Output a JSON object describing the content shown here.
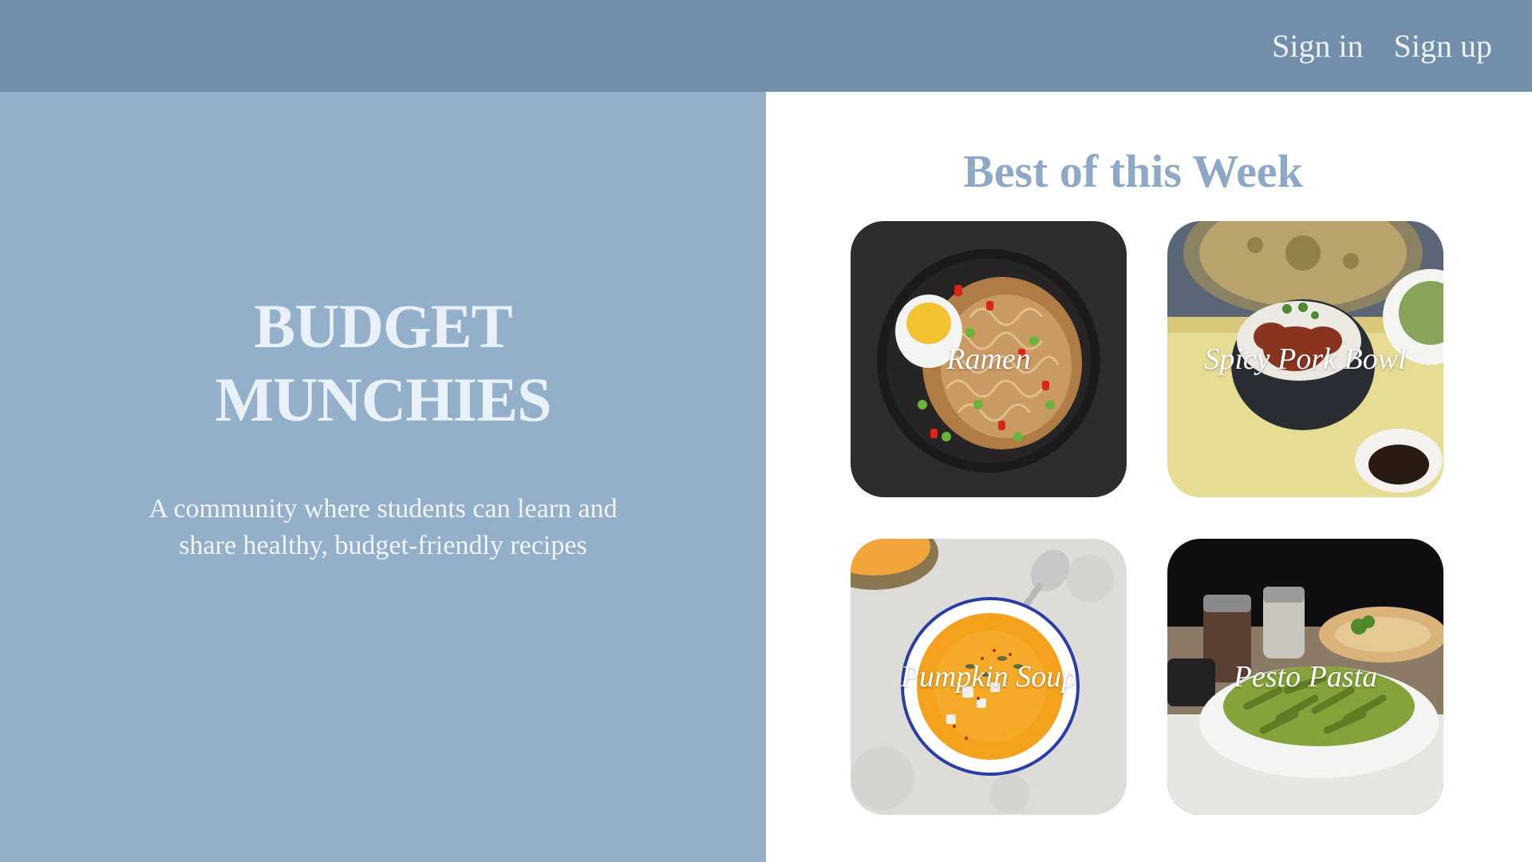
{
  "nav": {
    "sign_in": "Sign in",
    "sign_up": "Sign up"
  },
  "hero": {
    "title_line1": "BUDGET",
    "title_line2": "MUNCHIES",
    "subtitle": "A community where students can learn and share healthy, budget-friendly recipes"
  },
  "section": {
    "title": "Best of this Week"
  },
  "recipes": [
    {
      "label": "Ramen",
      "icon": "ramen-photo"
    },
    {
      "label": "Spicy Pork Bowl",
      "icon": "pork-bowl-photo"
    },
    {
      "label": "Pumpkin Soup",
      "icon": "pumpkin-soup-photo"
    },
    {
      "label": "Pesto Pasta",
      "icon": "pesto-pasta-photo"
    }
  ],
  "colors": {
    "topbar": "#728eab",
    "hero_bg": "#94afca",
    "accent_title": "#8fa8c5"
  }
}
